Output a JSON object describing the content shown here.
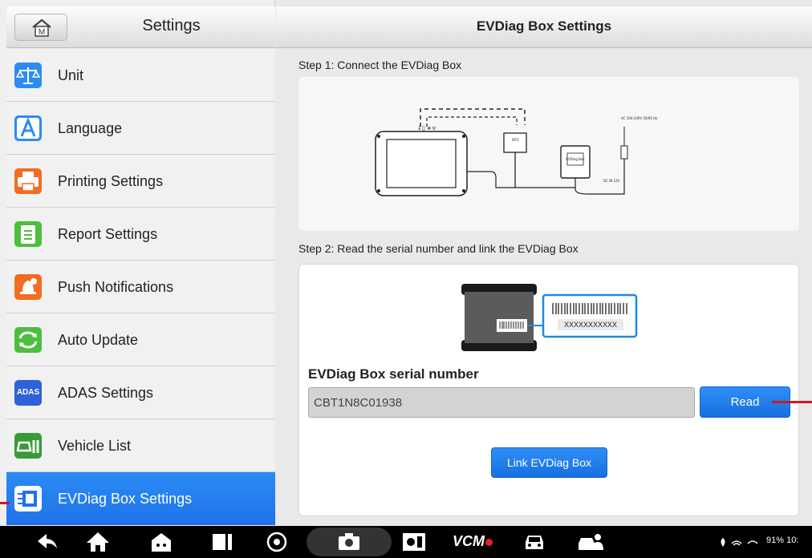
{
  "left_panel": {
    "title": "Settings",
    "home_icon_letter": "M",
    "items": [
      {
        "label": "Unit",
        "icon": "scale-icon",
        "color": "#2d8cf0"
      },
      {
        "label": "Language",
        "icon": "letter-a-icon",
        "color": "#2d8cf0"
      },
      {
        "label": "Printing Settings",
        "icon": "printer-icon",
        "color": "#f26c22"
      },
      {
        "label": "Report Settings",
        "icon": "clipboard-icon",
        "color": "#4cbf3c"
      },
      {
        "label": "Push Notifications",
        "icon": "bell-icon",
        "color": "#f26c22"
      },
      {
        "label": "Auto Update",
        "icon": "refresh-icon",
        "color": "#4cbf3c"
      },
      {
        "label": "ADAS Settings",
        "icon": "adas-icon",
        "color": "#2d62d8",
        "icon_text": "ADAS"
      },
      {
        "label": "Vehicle List",
        "icon": "vehicle-list-icon",
        "color": "#3a9a3a"
      },
      {
        "label": "EVDiag Box Settings",
        "icon": "evdiag-box-icon",
        "color": "#ffffff",
        "active": true
      }
    ]
  },
  "right_panel": {
    "title": "EVDiag Box Settings",
    "step1_label": "Step 1: Connect the EVDiag Box",
    "step2_label": "Step 2: Read the serial number and link the EVDiag Box",
    "diagram": {
      "vci_label": "VCI",
      "box_label": "EVDiag Box",
      "ac_label": "AC 100-240V 50/60 Hz",
      "dc_label": "DC IN 12V"
    },
    "device_serial_placeholder": "XXXXXXXXXXX",
    "serial_label": "EVDiag Box serial number",
    "serial_value": "CBT1N8C01938",
    "read_button": "Read",
    "link_button": "Link EVDiag Box"
  },
  "navbar": {
    "vcm_label": "VCM",
    "status": "91%  10:",
    "battery_percent": 91
  },
  "colors": {
    "accent": "#1f73e8",
    "annotation_arrow": "#d01822"
  }
}
